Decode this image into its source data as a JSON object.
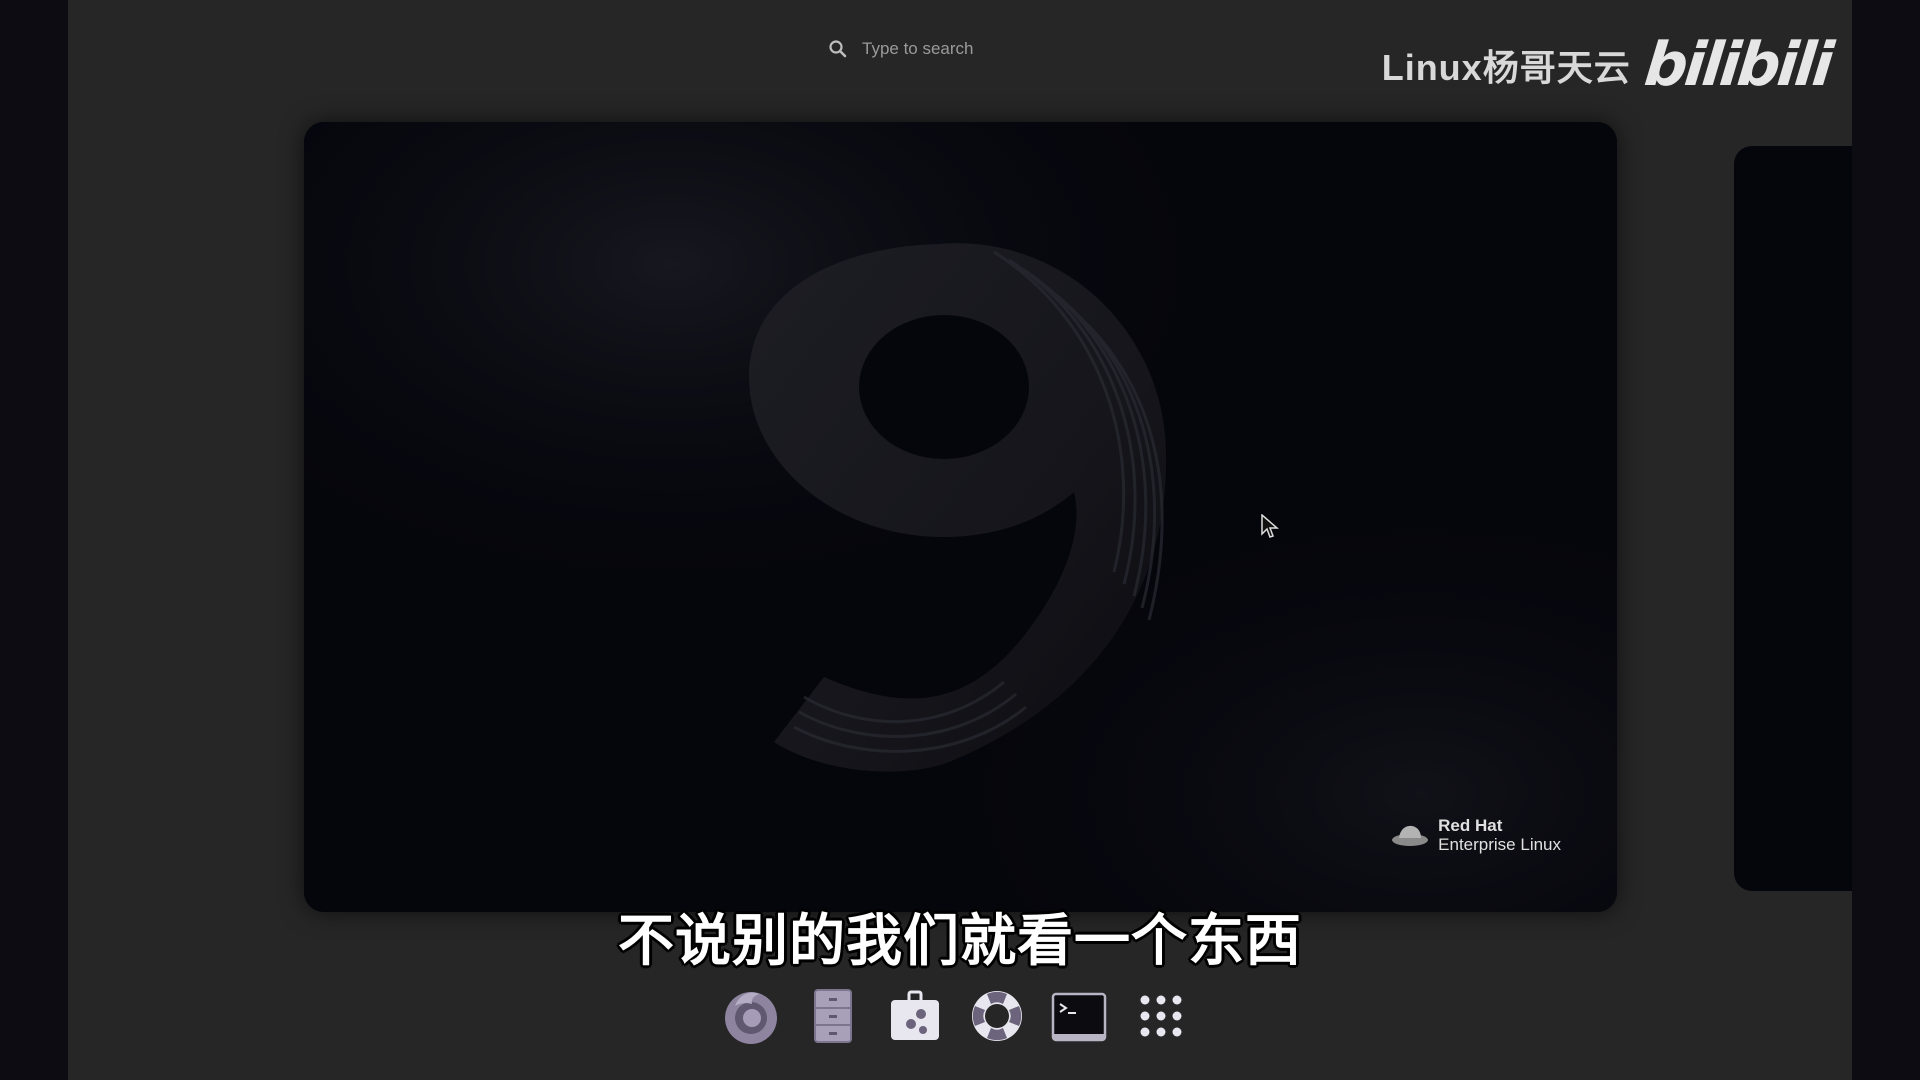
{
  "search": {
    "placeholder": "Type to search",
    "icon": "search-icon"
  },
  "watermark": {
    "channel": "Linux杨哥天云",
    "logo": "bilibili"
  },
  "wallpaper": {
    "badge_line1": "Red Hat",
    "badge_line2": "Enterprise Linux"
  },
  "subtitle": "不说别的我们就看一个东西",
  "dash": {
    "items": [
      {
        "name": "firefox",
        "icon": "firefox-icon"
      },
      {
        "name": "files",
        "icon": "files-icon"
      },
      {
        "name": "software",
        "icon": "software-icon"
      },
      {
        "name": "help",
        "icon": "help-lifebuoy-icon"
      },
      {
        "name": "terminal",
        "icon": "terminal-icon"
      },
      {
        "name": "show-applications",
        "icon": "app-grid-icon"
      }
    ]
  },
  "colors": {
    "overview_bg": "#262626",
    "workspace_bg": "#05050c",
    "accent": "#a89fb8"
  }
}
